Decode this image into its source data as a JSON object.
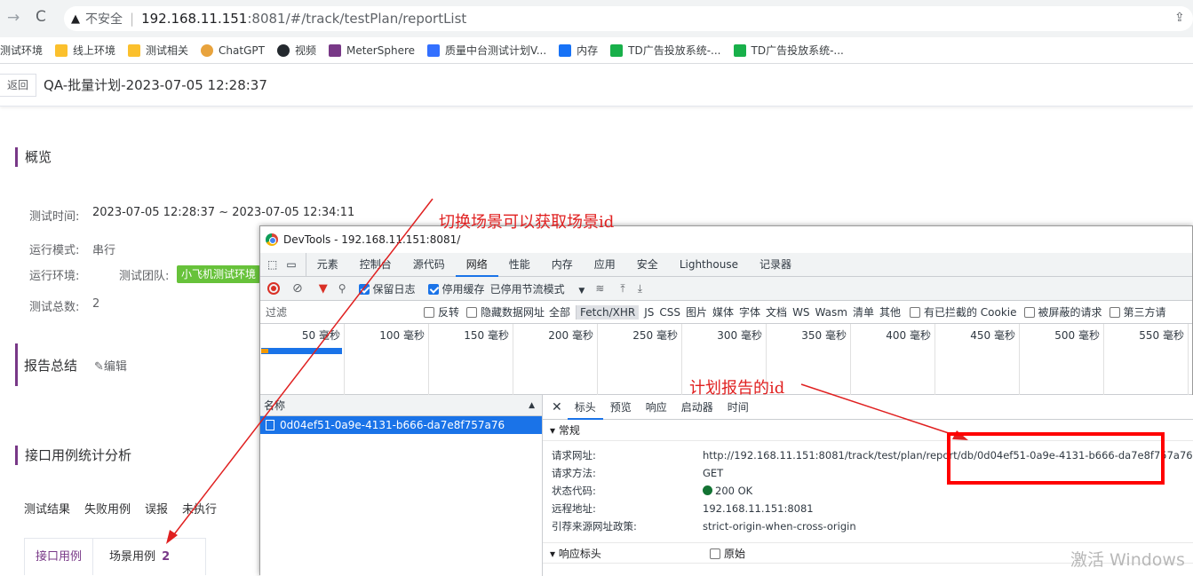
{
  "browser": {
    "address": {
      "warning": "不安全",
      "host": "192.168.11.151",
      "path": ":8081/#/track/testPlan/reportList"
    },
    "bookmarks": [
      "测试环境",
      "线上环境",
      "测试相关",
      "ChatGPT",
      "视频",
      "MeterSphere",
      "质量中台测试计划V...",
      "内存",
      "TD广告投放系统-...",
      "TD广告投放系统-..."
    ]
  },
  "page": {
    "back_label": "返回",
    "title": "QA-批量计划-2023-07-05 12:28:37",
    "overview": {
      "title": "概览",
      "test_time_label": "测试时间:",
      "test_time_value": "2023-07-05 12:28:37 ~ 2023-07-05 12:34:11",
      "run_mode_label": "运行模式:",
      "run_mode_value": "串行",
      "env_label": "运行环境:",
      "env_team_label": "测试团队:",
      "env_tag": "小飞机测试环境",
      "total_label": "测试总数:",
      "total_value": "2"
    },
    "summary": {
      "title": "报告总结",
      "edit_label": "编辑"
    },
    "api_stats": {
      "title": "接口用例统计分析",
      "tabs": [
        "测试结果",
        "失败用例",
        "误报",
        "未执行"
      ],
      "sub_tabs": [
        {
          "label": "接口用例",
          "count": ""
        },
        {
          "label": "场景用例",
          "count": "2"
        }
      ]
    }
  },
  "devtools": {
    "title": "DevTools - 192.168.11.151:8081/",
    "tabs": [
      "元素",
      "控制台",
      "源代码",
      "网络",
      "性能",
      "内存",
      "应用",
      "安全",
      "Lighthouse",
      "记录器"
    ],
    "active_tab": "网络",
    "toolbar": {
      "preserve_log": "保留日志",
      "disable_cache": "停用缓存",
      "throttle": "已停用节流模式"
    },
    "filter": {
      "placeholder": "过滤",
      "invert": "反转",
      "hide_data_urls": "隐藏数据网址",
      "types": [
        "全部",
        "Fetch/XHR",
        "JS",
        "CSS",
        "图片",
        "媒体",
        "字体",
        "文档",
        "WS",
        "Wasm",
        "清单",
        "其他"
      ],
      "blocked_cookies": "有已拦截的 Cookie",
      "blocked_requests": "被屏蔽的请求",
      "third_party": "第三方请"
    },
    "timeline_ticks": [
      "50 毫秒",
      "100 毫秒",
      "150 毫秒",
      "200 毫秒",
      "250 毫秒",
      "300 毫秒",
      "350 毫秒",
      "400 毫秒",
      "450 毫秒",
      "500 毫秒",
      "550 毫秒"
    ],
    "name_header": "名称",
    "request_name": "0d04ef51-0a9e-4131-b666-da7e8f757a76",
    "detail_tabs": [
      "标头",
      "预览",
      "响应",
      "启动器",
      "时间"
    ],
    "general": {
      "title": "常规",
      "rows": [
        {
          "k": "请求网址:",
          "v": "http://192.168.11.151:8081/track/test/plan/report/db/0d04ef51-0a9e-4131-b666-da7e8f757a76"
        },
        {
          "k": "请求方法:",
          "v": "GET"
        },
        {
          "k": "状态代码:",
          "v": "200 OK"
        },
        {
          "k": "远程地址:",
          "v": "192.168.11.151:8081"
        },
        {
          "k": "引荐来源网址政策:",
          "v": "strict-origin-when-cross-origin"
        }
      ]
    },
    "response_headers": {
      "title": "响应标头",
      "raw": "原始"
    }
  },
  "annotations": {
    "scene_note": "切换场景可以获取场景id",
    "report_note": "计划报告的id"
  },
  "watermark": "激活 Windows",
  "colors": {
    "accent": "#783887",
    "annotation": "#e02020",
    "tag_green": "#67c23a",
    "devtools_blue": "#1a73e8"
  }
}
